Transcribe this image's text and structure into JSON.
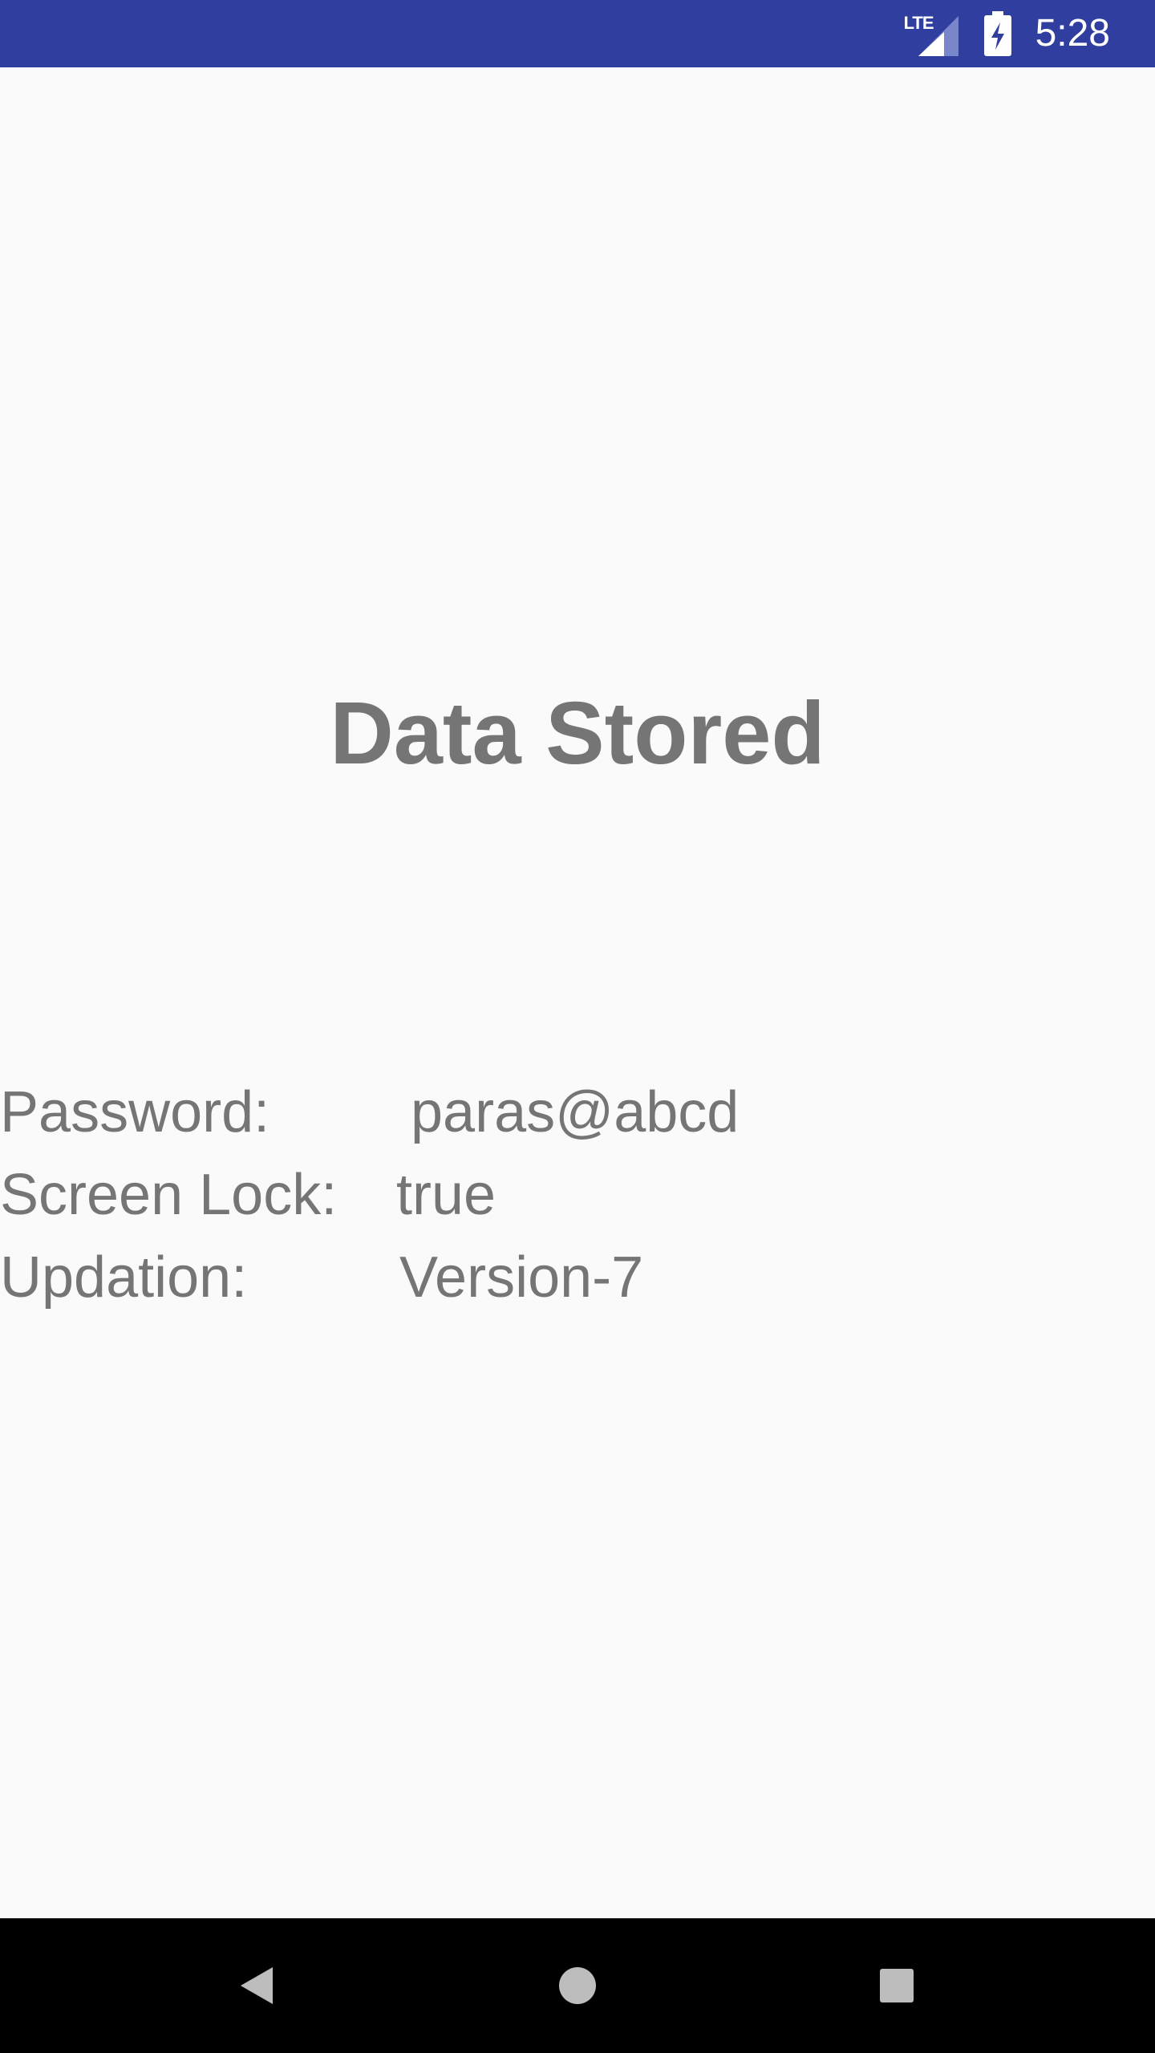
{
  "status_bar": {
    "network_label": "LTE",
    "time": "5:28",
    "background_color": "#303f9f"
  },
  "main": {
    "title": "Data Stored",
    "rows": [
      {
        "label": "Password:",
        "value": "paras@abcd"
      },
      {
        "label": "Screen Lock:",
        "value": "true"
      },
      {
        "label": "Updation:",
        "value": "Version-7"
      }
    ],
    "text_color": "#757575"
  },
  "nav_bar": {
    "back_icon": "back-triangle-icon",
    "home_icon": "home-circle-icon",
    "recent_icon": "recent-square-icon"
  }
}
